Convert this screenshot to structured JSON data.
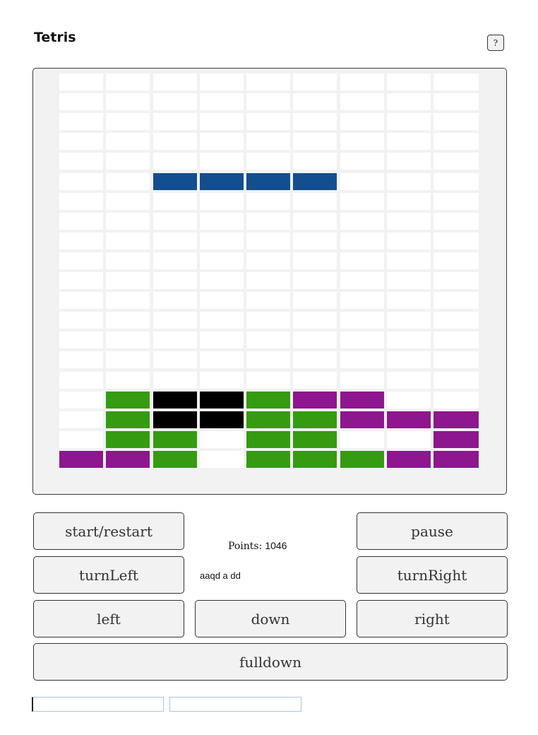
{
  "app": {
    "title": "Tetris",
    "help_label": "?"
  },
  "board": {
    "columns": 9,
    "rows": 20,
    "colors": {
      "empty": "#ffffff",
      "blue": "#134f8f",
      "green": "#359b10",
      "black": "#000000",
      "purple": "#8e168e"
    },
    "cells": [
      ".........",
      ".........",
      ".........",
      ".........",
      ".........",
      "..BBBB...",
      ".........",
      ".........",
      ".........",
      ".........",
      ".........",
      ".........",
      ".........",
      ".........",
      ".........",
      ".........",
      ".GKKGPP..",
      ".GKKGGPPP",
      ".GG.GG..P",
      "PPG.GGGPP"
    ],
    "legend": {
      ".": "empty",
      "B": "blue",
      "G": "green",
      "K": "black",
      "P": "purple"
    }
  },
  "controls": {
    "start_restart": "start/restart",
    "pause": "pause",
    "turn_left": "turnLeft",
    "turn_right": "turnRight",
    "left": "left",
    "down": "down",
    "right": "right",
    "full_down": "fulldown"
  },
  "score": {
    "label": "Points:",
    "value": "1046"
  },
  "key_log": "aaqd a dd",
  "inputs": {
    "first_value": "",
    "second_value": ""
  }
}
